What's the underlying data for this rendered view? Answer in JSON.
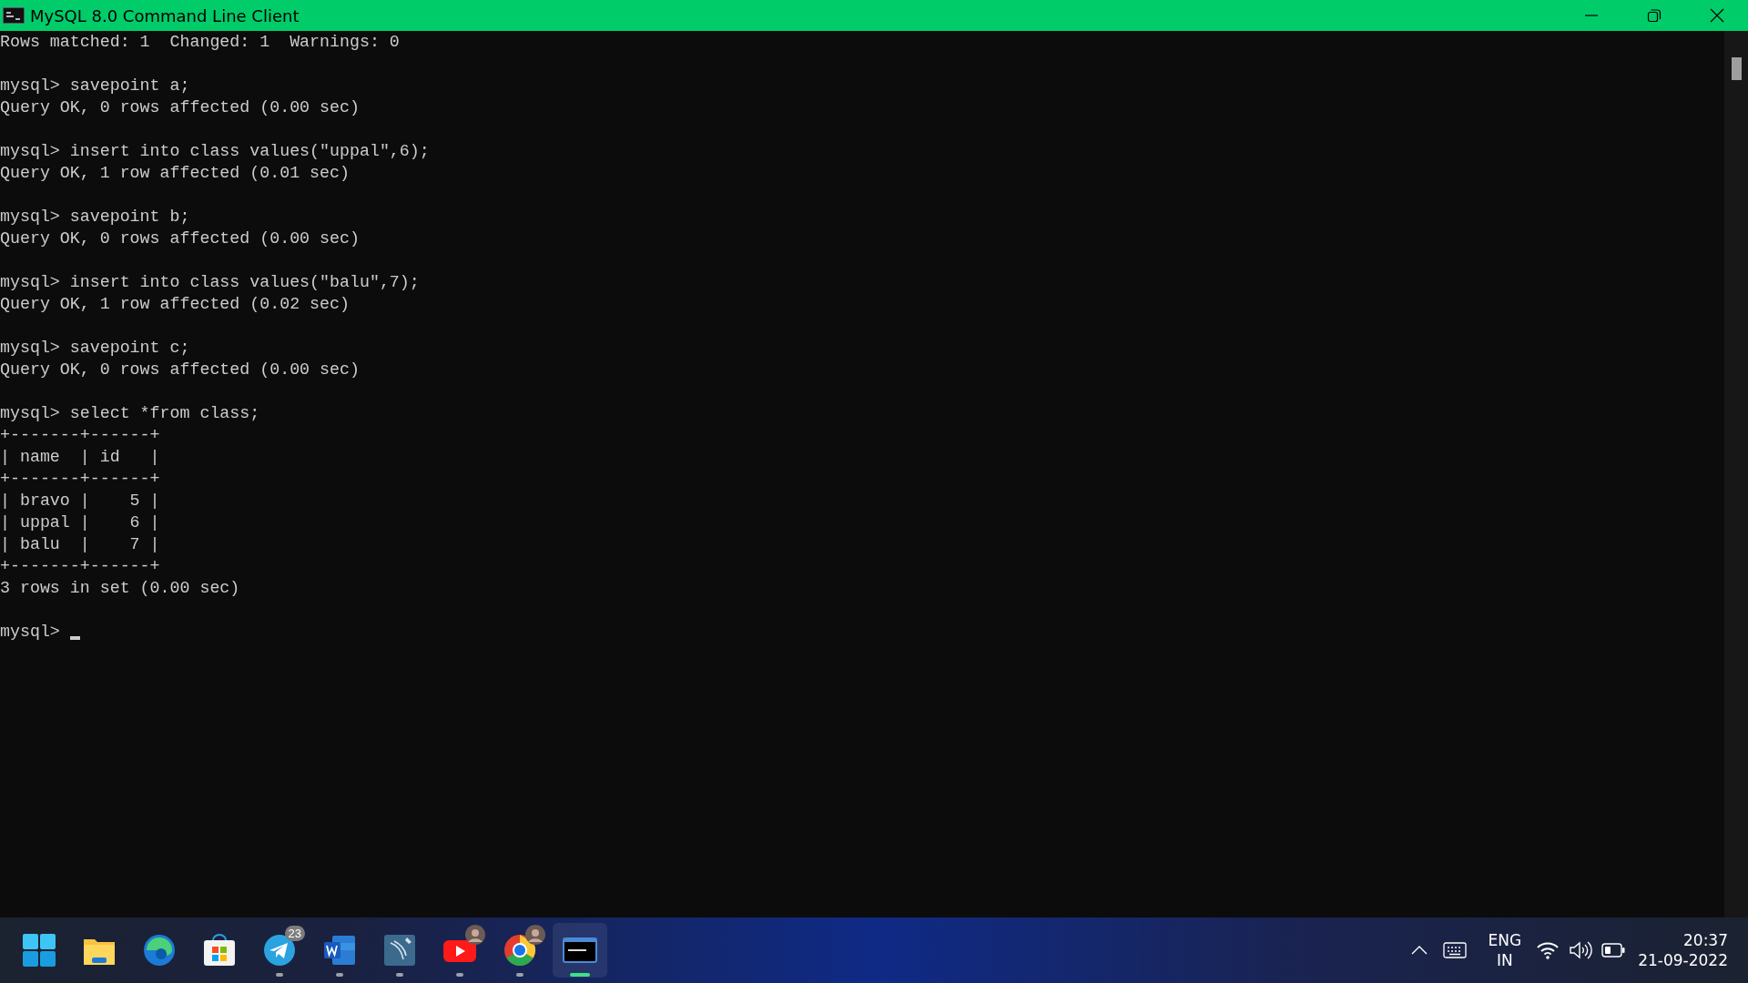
{
  "window": {
    "title": "MySQL 8.0 Command Line Client"
  },
  "console": {
    "blocks": [
      [
        "Rows matched: 1  Changed: 1  Warnings: 0"
      ],
      [
        "mysql> savepoint a;",
        "Query OK, 0 rows affected (0.00 sec)"
      ],
      [
        "mysql> insert into class values(\"uppal\",6);",
        "Query OK, 1 row affected (0.01 sec)"
      ],
      [
        "mysql> savepoint b;",
        "Query OK, 0 rows affected (0.00 sec)"
      ],
      [
        "mysql> insert into class values(\"balu\",7);",
        "Query OK, 1 row affected (0.02 sec)"
      ],
      [
        "mysql> savepoint c;",
        "Query OK, 0 rows affected (0.00 sec)"
      ],
      [
        "mysql> select *from class;",
        "+-------+------+",
        "| name  | id   |",
        "+-------+------+",
        "| bravo |    5 |",
        "| uppal |    6 |",
        "| balu  |    7 |",
        "+-------+------+",
        "3 rows in set (0.00 sec)"
      ]
    ],
    "prompt": "mysql>"
  },
  "taskbar": {
    "apps": [
      {
        "kind": "start",
        "running": false,
        "selected": false
      },
      {
        "kind": "files",
        "running": false,
        "selected": false
      },
      {
        "kind": "edge",
        "running": false,
        "selected": false
      },
      {
        "kind": "store",
        "running": false,
        "selected": false
      },
      {
        "kind": "telegram",
        "running": true,
        "selected": false,
        "badge": "23"
      },
      {
        "kind": "word",
        "running": true,
        "selected": false
      },
      {
        "kind": "workbench",
        "running": true,
        "selected": false
      },
      {
        "kind": "youtube",
        "running": true,
        "selected": false,
        "avatar": true
      },
      {
        "kind": "chrome",
        "running": true,
        "selected": false,
        "avatar": true
      },
      {
        "kind": "terminal",
        "running": true,
        "selected": true
      }
    ],
    "tray": {
      "language": [
        "ENG",
        "IN"
      ],
      "time": "20:37",
      "date": "21-09-2022"
    }
  }
}
